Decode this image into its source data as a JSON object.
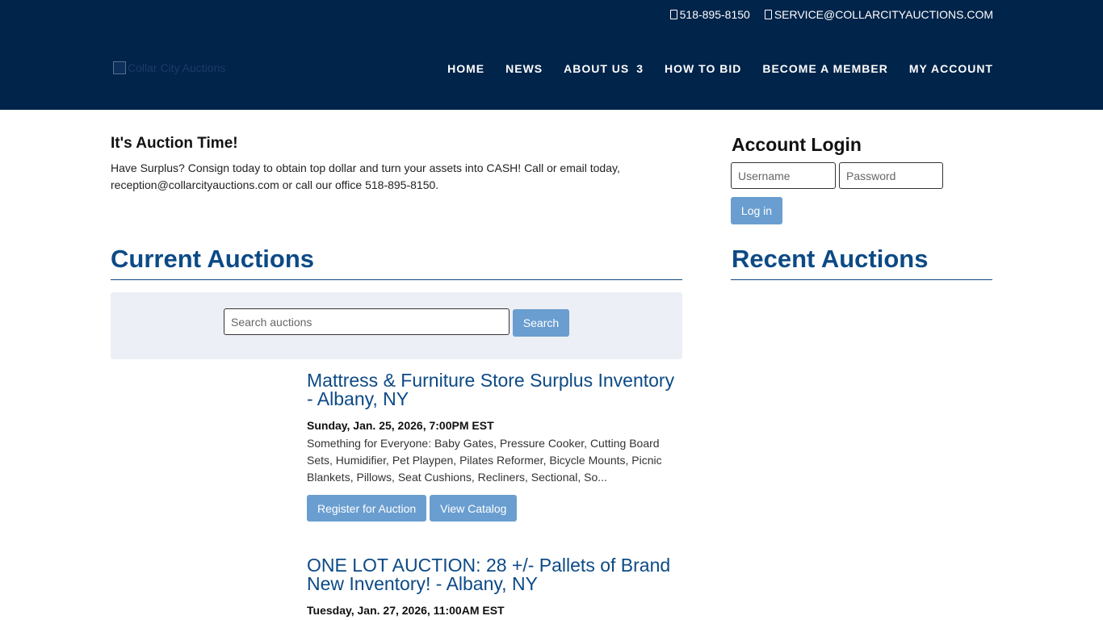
{
  "header": {
    "phone": "518-895-8150",
    "email": "SERVICE@COLLARCITYAUCTIONS.COM",
    "logo_alt": "Collar City Auctions",
    "nav": [
      {
        "label": "HOME"
      },
      {
        "label": "NEWS"
      },
      {
        "label": "ABOUT US",
        "caret": "3"
      },
      {
        "label": "HOW TO BID"
      },
      {
        "label": "BECOME A MEMBER"
      },
      {
        "label": "MY ACCOUNT"
      }
    ]
  },
  "intro": {
    "title": "It's Auction Time!",
    "text": "Have Surplus? Consign today to obtain top dollar and turn your assets into CASH! Call or email today, reception@collarcityauctions.com or call our office 518-895-8150."
  },
  "current_auctions": {
    "heading": "Current Auctions",
    "search_placeholder": "Search auctions",
    "search_button": "Search",
    "items": [
      {
        "title": "Mattress & Furniture Store Surplus Inventory - Albany, NY",
        "date": "Sunday, Jan. 25, 2026, 7:00PM EST",
        "description": "Something for Everyone: Baby Gates, Pressure Cooker, Cutting Board Sets, Humidifier, Pet Playpen, Pilates Reformer, Bicycle Mounts, Picnic Blankets, Pillows, Seat Cushions, Recliners, Sectional, So...",
        "register_label": "Register for Auction",
        "catalog_label": "View Catalog"
      },
      {
        "title": "ONE LOT AUCTION: 28 +/- Pallets of Brand New Inventory! - Albany, NY",
        "date": "Tuesday, Jan. 27, 2026, 11:00AM EST"
      }
    ]
  },
  "sidebar": {
    "login_heading": "Account Login",
    "username_placeholder": "Username",
    "password_placeholder": "Password",
    "login_button": "Log in",
    "recent_heading": "Recent Auctions"
  },
  "colors": {
    "header_bg": "#01244a",
    "accent": "#0c4a86",
    "button": "#6a9ed0",
    "panel": "#eceff5"
  },
  "icons": [
    "phone-icon",
    "envelope-icon",
    "broken-image-icon"
  ]
}
